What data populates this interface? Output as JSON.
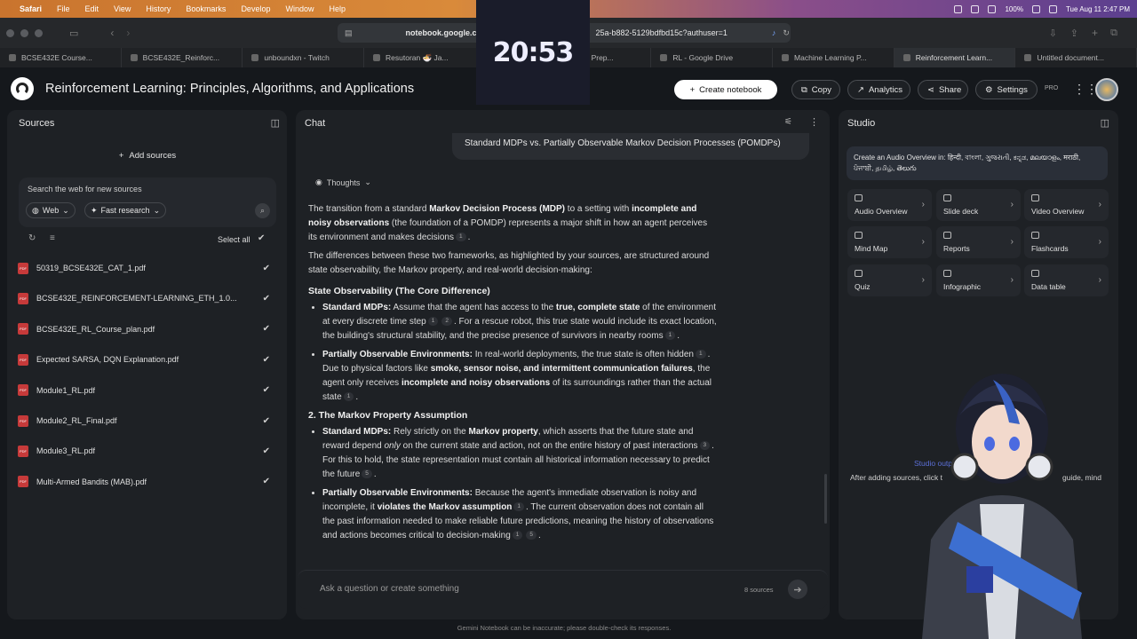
{
  "menubar": {
    "app": "Safari",
    "items": [
      "File",
      "Edit",
      "View",
      "History",
      "Bookmarks",
      "Develop",
      "Window",
      "Help"
    ],
    "battery": "100%",
    "datetime": "Tue Aug 11  2:47 PM"
  },
  "browser": {
    "url_left": "notebook.google.c",
    "url_right": "25a-b882-5129bdfbd15c?authuser=1",
    "clock": "20:53"
  },
  "tabs": [
    "BCSE432E Course...",
    "BCSE432E_Reinforc...",
    "unboundxn - Twitch",
    "Resutoran 🍜 Ja...",
    "Effective Exam Prep...",
    "RL - Google Drive",
    "Machine Learning P...",
    "Reinforcement Learn...",
    "Untitled document..."
  ],
  "header": {
    "title": "Reinforcement Learning: Principles, Algorithms, and Applications",
    "create": "Create notebook",
    "copy": "Copy",
    "analytics": "Analytics",
    "share": "Share",
    "settings": "Settings",
    "pro": "PRO"
  },
  "sources": {
    "title": "Sources",
    "add": "Add sources",
    "search_label": "Search the web for new sources",
    "web": "Web",
    "research": "Fast research",
    "select_all": "Select all",
    "files": [
      "50319_BCSE432E_CAT_1.pdf",
      "BCSE432E_REINFORCEMENT-LEARNING_ETH_1.0...",
      "BCSE432E_RL_Course_plan.pdf",
      "Expected SARSA, DQN Explanation.pdf",
      "Module1_RL.pdf",
      "Module2_RL_Final.pdf",
      "Module3_RL.pdf",
      "Multi-Armed Bandits (MAB).pdf"
    ]
  },
  "chat": {
    "title": "Chat",
    "user_msg": "Standard MDPs vs. Partially Observable Markov Decision Processes (POMDPs)",
    "thoughts": "Thoughts",
    "p1a": "The transition from a standard ",
    "p1b": "Markov Decision Process (MDP)",
    "p1c": " to a setting with ",
    "p1d": "incomplete and noisy observations",
    "p1e": " (the foundation of a POMDP) represents a major shift in how an agent perceives its environment and makes decisions",
    "p2": "The differences between these two frameworks, as highlighted by your sources, are structured around state observability, the Markov property, and real-world decision-making:",
    "h1": "State Observability (The Core Difference)",
    "b1a": "Standard MDPs:",
    "b1b": " Assume that the agent has access to the ",
    "b1c": "true, complete state",
    "b1d": " of the environment at every discrete time step",
    "b1e": ". For a rescue robot, this true state would include its exact location, the building's structural stability, and the precise presence of survivors in nearby rooms",
    "b2a": "Partially Observable Environments:",
    "b2b": " In real-world deployments, the true state is often hidden",
    "b2c": ". Due to physical factors like ",
    "b2d": "smoke, sensor noise, and intermittent communication failures",
    "b2e": ", the agent only receives ",
    "b2f": "incomplete and noisy observations",
    "b2g": " of its surroundings rather than the actual state",
    "h2": "2. The Markov Property Assumption",
    "b3a": "Standard MDPs:",
    "b3b": " Rely strictly on the ",
    "b3c": "Markov property",
    "b3d": ", which asserts that the future state and reward depend ",
    "b3e": "only",
    "b3f": " on the current state and action, not on the entire history of past interactions",
    "b3g": ". For this to hold, the state representation must contain all historical information necessary to predict the future",
    "b4a": "Partially Observable Environments:",
    "b4b": " Because the agent's immediate observation is noisy and incomplete, it ",
    "b4c": "violates the Markov assumption",
    "b4d": ". The current observation does not contain all the past information needed to make reliable future predictions, meaning the history of observations and actions becomes critical to decision-making",
    "input_placeholder": "Ask a question or create something",
    "source_count": "8 sources",
    "disclaimer": "Gemini Notebook can be inaccurate; please double-check its responses."
  },
  "studio": {
    "title": "Studio",
    "banner": "Create an Audio Overview in: हिन्दी, বাংলা, ગુજરાતી, ಕನ್ನಡ, മലയാളം, मराठी, ਪੰਜਾਬੀ, தமிழ், తెలుగు",
    "tiles": [
      "Audio Overview",
      "Slide deck",
      "Video Overview",
      "Mind Map",
      "Reports",
      "Flashcards",
      "Quiz",
      "Infographic",
      "Data table"
    ],
    "output_label": "Studio output",
    "output_hint": "After adding sources, click t",
    "output_hint2": "guide, mind"
  }
}
